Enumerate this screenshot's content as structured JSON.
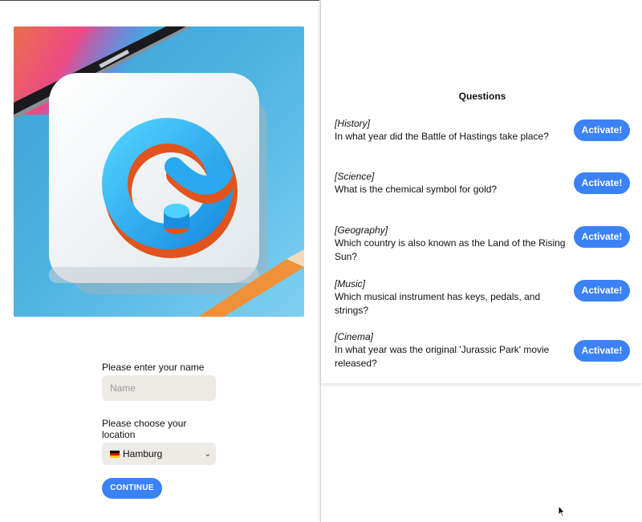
{
  "login": {
    "name_label": "Please enter your name",
    "name_placeholder": "Name",
    "name_value": "",
    "location_label": "Please choose your location",
    "location_value": "Hamburg",
    "location_flag": "german-flag",
    "continue_label": "CONTINUE"
  },
  "questions": {
    "title": "Questions",
    "activate_label": "Activate!",
    "items": [
      {
        "category": "[History]",
        "text": "In what year did the Battle of Hastings take place?"
      },
      {
        "category": "[Science]",
        "text": "What is the chemical symbol for gold?"
      },
      {
        "category": "[Geography]",
        "text": "Which country is also known as the Land of the Rising Sun?"
      },
      {
        "category": "[Music]",
        "text": "Which musical instrument has keys, pedals, and strings?"
      },
      {
        "category": "[Cinema]",
        "text": "In what year was the original 'Jurassic Park' movie released?"
      }
    ]
  },
  "colors": {
    "accent": "#3b82f6",
    "input_bg": "#edebe6"
  },
  "icons": {
    "hero": "quiz-logo-image",
    "cursor": "mouse-cursor-icon"
  }
}
